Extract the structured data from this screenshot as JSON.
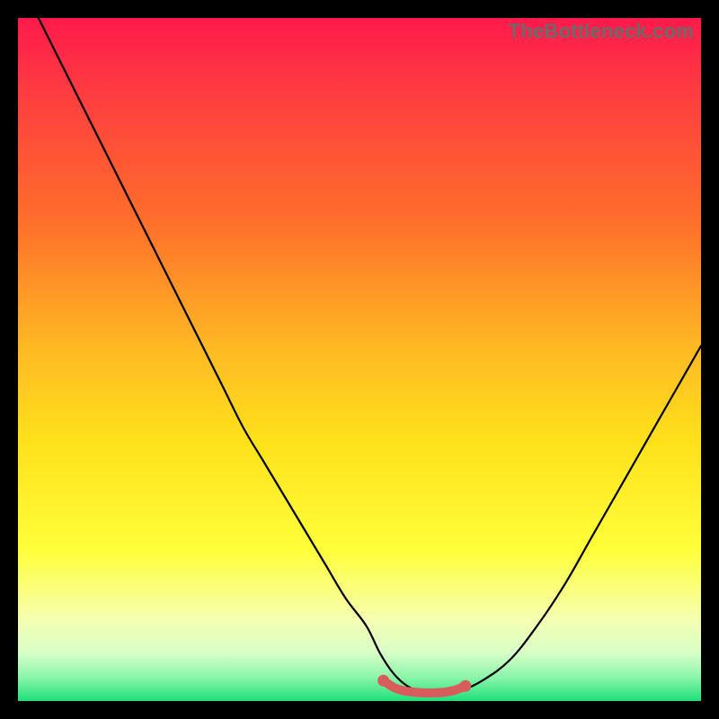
{
  "watermark": "TheBottleneck.com",
  "colors": {
    "frame": "#000000",
    "curve": "#000000",
    "marker": "#d95c5c",
    "gradient_stops": [
      {
        "offset": 0.0,
        "color": "#ff1a4b"
      },
      {
        "offset": 0.12,
        "color": "#ff3f3f"
      },
      {
        "offset": 0.3,
        "color": "#ff6f2a"
      },
      {
        "offset": 0.48,
        "color": "#ffb824"
      },
      {
        "offset": 0.62,
        "color": "#ffe11a"
      },
      {
        "offset": 0.78,
        "color": "#ffff3a"
      },
      {
        "offset": 0.88,
        "color": "#f6ffb0"
      },
      {
        "offset": 0.93,
        "color": "#d7ffc8"
      },
      {
        "offset": 0.965,
        "color": "#8cf5a8"
      },
      {
        "offset": 1.0,
        "color": "#1ee07a"
      }
    ]
  },
  "chart_data": {
    "type": "line",
    "title": "",
    "xlabel": "",
    "ylabel": "",
    "xlim": [
      0,
      100
    ],
    "ylim": [
      0,
      100
    ],
    "grid": false,
    "legend": false,
    "series": [
      {
        "name": "bottleneck-curve",
        "x": [
          3,
          6,
          9,
          12,
          15,
          18,
          21,
          24,
          27,
          30,
          33,
          36,
          39,
          42,
          45,
          48,
          51,
          53,
          55,
          57,
          59,
          61,
          63,
          65,
          68,
          72,
          76,
          80,
          84,
          88,
          92,
          96,
          100
        ],
        "y": [
          100,
          94,
          88,
          82,
          76,
          70,
          64,
          58,
          52,
          46,
          40,
          35,
          30,
          25,
          20,
          15,
          11,
          7,
          4,
          2.2,
          1.4,
          1.2,
          1.2,
          1.6,
          3,
          6,
          11,
          17,
          24,
          31,
          38,
          45,
          52
        ]
      },
      {
        "name": "optimal-zone-marker",
        "x": [
          53.5,
          55,
          56.5,
          58,
          59.5,
          61,
          62.5,
          64,
          65.5
        ],
        "y": [
          3.0,
          2.0,
          1.5,
          1.3,
          1.2,
          1.2,
          1.3,
          1.6,
          2.2
        ]
      }
    ],
    "annotations": [
      {
        "text": "TheBottleneck.com",
        "pos": "top-right"
      }
    ]
  }
}
